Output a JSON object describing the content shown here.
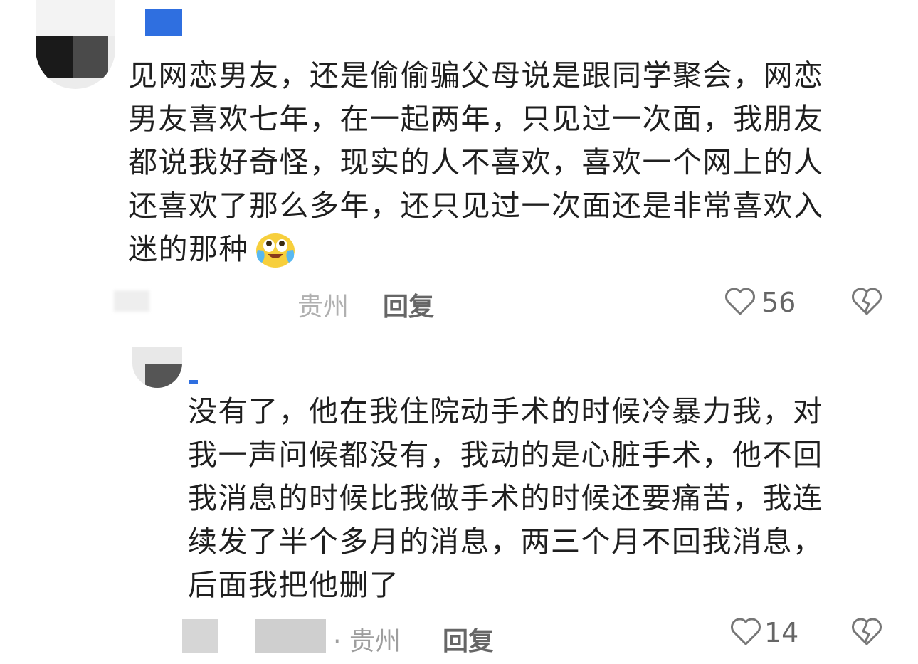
{
  "comment1": {
    "lines": [
      "见网恋男友，还是偷偷骗父母说是跟同学聚会，网恋",
      "男友喜欢七年，在一起两年，只见过一次面，我朋友",
      "都说我好奇怪，现实的人不喜欢，喜欢一个网上的人",
      "还喜欢了那么多年，还只见过一次面还是非常喜欢入",
      "迷的那种"
    ],
    "location": "贵州",
    "reply_label": "回复",
    "like_count": "56",
    "accent_color": "#2f6fe0"
  },
  "comment2": {
    "lines": [
      "没有了，他在我住院动手术的时候冷暴力我，对",
      "我一声问候都没有，我动的是心脏手术，他不回",
      "我消息的时候比我做手术的时候还要痛苦，我连",
      "续发了半个多月的消息，两三个月不回我消息，",
      "后面我把他删了"
    ],
    "location": "· 贵州",
    "reply_label": "回复",
    "like_count": "14"
  }
}
